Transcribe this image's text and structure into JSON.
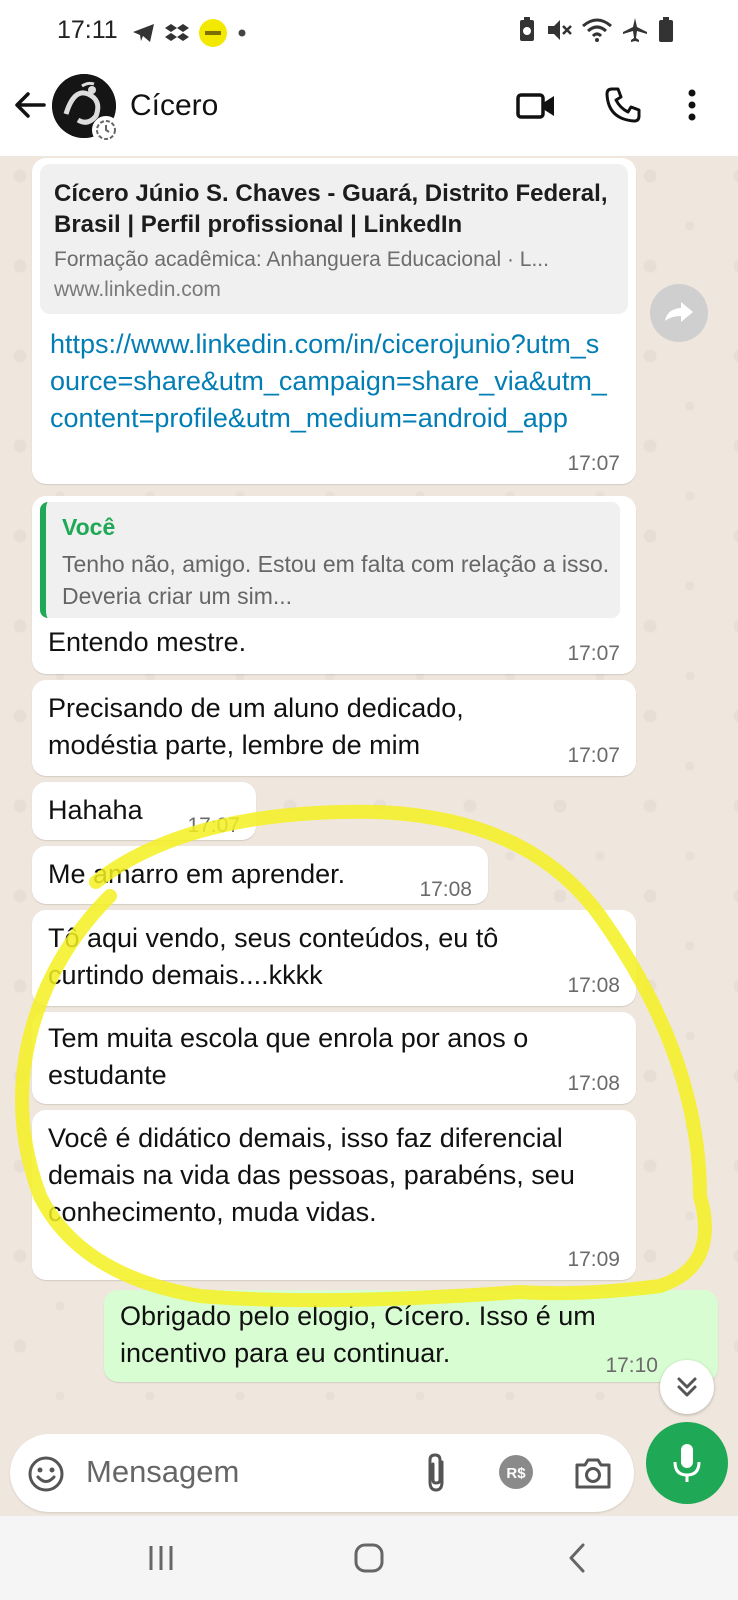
{
  "status_bar": {
    "time": "17:11",
    "left_icons": [
      "telegram-icon",
      "dropbox-icon",
      "app-badge-icon",
      "dot-icon"
    ],
    "right_icons": [
      "battery-saver-icon",
      "mute-icon",
      "wifi-icon",
      "airplane-icon",
      "battery-icon"
    ]
  },
  "header": {
    "contact_name": "Cícero",
    "actions": [
      "video-call-icon",
      "voice-call-icon",
      "more-icon"
    ]
  },
  "messages": {
    "m1": {
      "preview_title": "Cícero Júnio S. Chaves - Guará, Distrito Federal, Brasil | Perfil profissional | LinkedIn",
      "preview_desc": "Formação acadêmica: Anhanguera Educacional · L...",
      "preview_domain": "www.linkedin.com",
      "url": "https://www.linkedin.com/in/cicerojunio?utm_source=share&utm_campaign=share_via&utm_content=profile&utm_medium=android_app",
      "time": "17:07"
    },
    "m2": {
      "quote_author": "Você",
      "quote_text": "Tenho não, amigo. Estou em falta com relação a isso. Deveria criar um sim...",
      "text": "Entendo mestre.",
      "time": "17:07"
    },
    "m3": {
      "text": "Precisando de um aluno dedicado, modéstia parte, lembre de mim",
      "time": "17:07"
    },
    "m4": {
      "text": "Hahaha",
      "time": "17:07"
    },
    "m5": {
      "text": "Me amarro em aprender.",
      "time": "17:08"
    },
    "m6": {
      "text": "Tô aqui vendo, seus conteúdos, eu tô curtindo demais....kkkk",
      "time": "17:08"
    },
    "m7": {
      "text": "Tem muita escola que enrola por anos o estudante",
      "time": "17:08"
    },
    "m8": {
      "text": "Você é didático demais, isso faz diferencial demais na vida das pessoas, parabéns, seu conhecimento, muda vidas.",
      "time": "17:09"
    },
    "m9": {
      "text": "Obrigado pelo elogio, Cícero. Isso é um incentivo para eu continuar.",
      "time": "17:10",
      "outgoing": true
    }
  },
  "input": {
    "placeholder": "Mensagem"
  },
  "colors": {
    "accent": "#1fa855",
    "link": "#027eb5",
    "outgoing_bubble": "#d9fdd3",
    "highlight": "#f5f020"
  }
}
